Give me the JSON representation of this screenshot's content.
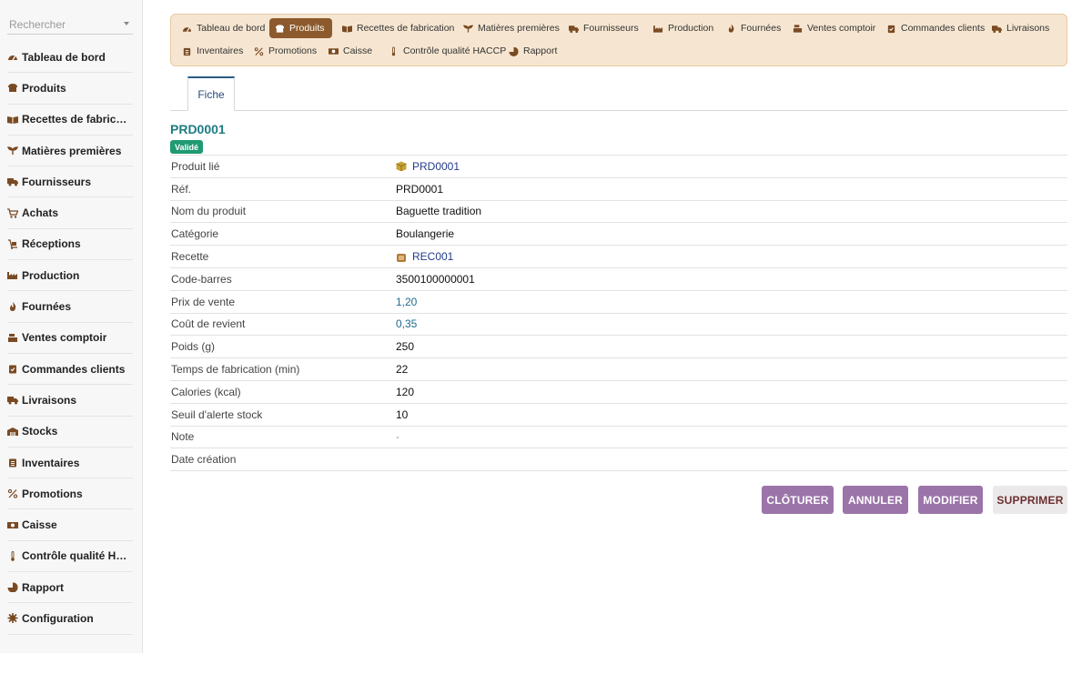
{
  "sidebar": {
    "search_placeholder": "Rechercher",
    "items": [
      {
        "label": "Tableau de bord",
        "icon": "gauge-icon"
      },
      {
        "label": "Produits",
        "icon": "bread-icon"
      },
      {
        "label": "Recettes de fabrication",
        "icon": "book-icon"
      },
      {
        "label": "Matières premières",
        "icon": "seedling-icon"
      },
      {
        "label": "Fournisseurs",
        "icon": "truck-icon"
      },
      {
        "label": "Achats",
        "icon": "cart-icon"
      },
      {
        "label": "Réceptions",
        "icon": "dolly-icon"
      },
      {
        "label": "Production",
        "icon": "factory-icon"
      },
      {
        "label": "Fournées",
        "icon": "flame-icon"
      },
      {
        "label": "Ventes comptoir",
        "icon": "cash-register-icon"
      },
      {
        "label": "Commandes clients",
        "icon": "clipboard-check-icon"
      },
      {
        "label": "Livraisons",
        "icon": "shipping-icon"
      },
      {
        "label": "Stocks",
        "icon": "warehouse-icon"
      },
      {
        "label": "Inventaires",
        "icon": "clipboard-list-icon"
      },
      {
        "label": "Promotions",
        "icon": "percent-icon"
      },
      {
        "label": "Caisse",
        "icon": "money-icon"
      },
      {
        "label": "Contrôle qualité HACCP",
        "icon": "thermometer-icon"
      },
      {
        "label": "Rapport",
        "icon": "pie-chart-icon"
      },
      {
        "label": "Configuration",
        "icon": "gear-icon"
      }
    ]
  },
  "topnav": {
    "items": [
      {
        "label": "Tableau de bord",
        "icon": "gauge-icon",
        "active": false
      },
      {
        "label": "Produits",
        "icon": "bread-icon",
        "active": true
      },
      {
        "label": "Recettes de fabrication",
        "icon": "book-icon",
        "active": false
      },
      {
        "label": "Matières premières",
        "icon": "seedling-icon",
        "active": false
      },
      {
        "label": "Fournisseurs",
        "icon": "truck-icon",
        "active": false
      },
      {
        "label": "Production",
        "icon": "factory-icon",
        "active": false
      },
      {
        "label": "Fournées",
        "icon": "flame-icon",
        "active": false
      },
      {
        "label": "Ventes comptoir",
        "icon": "cash-register-icon",
        "active": false
      },
      {
        "label": "Commandes clients",
        "icon": "clipboard-check-icon",
        "active": false
      },
      {
        "label": "Livraisons",
        "icon": "shipping-icon",
        "active": false
      },
      {
        "label": "Inventaires",
        "icon": "clipboard-list-icon",
        "active": false
      },
      {
        "label": "Promotions",
        "icon": "percent-icon",
        "active": false
      },
      {
        "label": "Caisse",
        "icon": "money-icon",
        "active": false
      },
      {
        "label": "Contrôle qualité HACCP",
        "icon": "thermometer-icon",
        "active": false
      },
      {
        "label": "Rapport",
        "icon": "pie-chart-icon",
        "active": false
      }
    ]
  },
  "tabs": {
    "fiche": "Fiche"
  },
  "record": {
    "title": "PRD0001",
    "status": "Validé",
    "fields": [
      {
        "label": "Produit lié",
        "value": "PRD0001",
        "kind": "link",
        "icon": "box-icon"
      },
      {
        "label": "Réf.",
        "value": "PRD0001",
        "kind": "text"
      },
      {
        "label": "Nom du produit",
        "value": "Baguette tradition",
        "kind": "text"
      },
      {
        "label": "Catégorie",
        "value": "Boulangerie",
        "kind": "text"
      },
      {
        "label": "Recette",
        "value": "REC001",
        "kind": "link",
        "icon": "recipe-icon"
      },
      {
        "label": "Code-barres",
        "value": "3500100000001",
        "kind": "text"
      },
      {
        "label": "Prix de vente",
        "value": "1,20",
        "kind": "amount"
      },
      {
        "label": "Coût de revient",
        "value": "0,35",
        "kind": "amount"
      },
      {
        "label": "Poids (g)",
        "value": "250",
        "kind": "text"
      },
      {
        "label": "Temps de fabrication (min)",
        "value": "22",
        "kind": "text"
      },
      {
        "label": "Calories (kcal)",
        "value": "120",
        "kind": "text"
      },
      {
        "label": "Seuil d'alerte stock",
        "value": "10",
        "kind": "text"
      },
      {
        "label": "Note",
        "value": "-",
        "kind": "muted"
      },
      {
        "label": "Date création",
        "value": "",
        "kind": "text"
      }
    ]
  },
  "actions": {
    "close": "CLÔTURER",
    "cancel": "ANNULER",
    "edit": "MODIFIER",
    "delete": "SUPPRIMER"
  },
  "colors": {
    "accent": "#8c5a2c",
    "icon": "#7a4a22",
    "status_green": "#1f9a73",
    "title_teal": "#1d7c82",
    "button_purple": "#9b74a9"
  }
}
